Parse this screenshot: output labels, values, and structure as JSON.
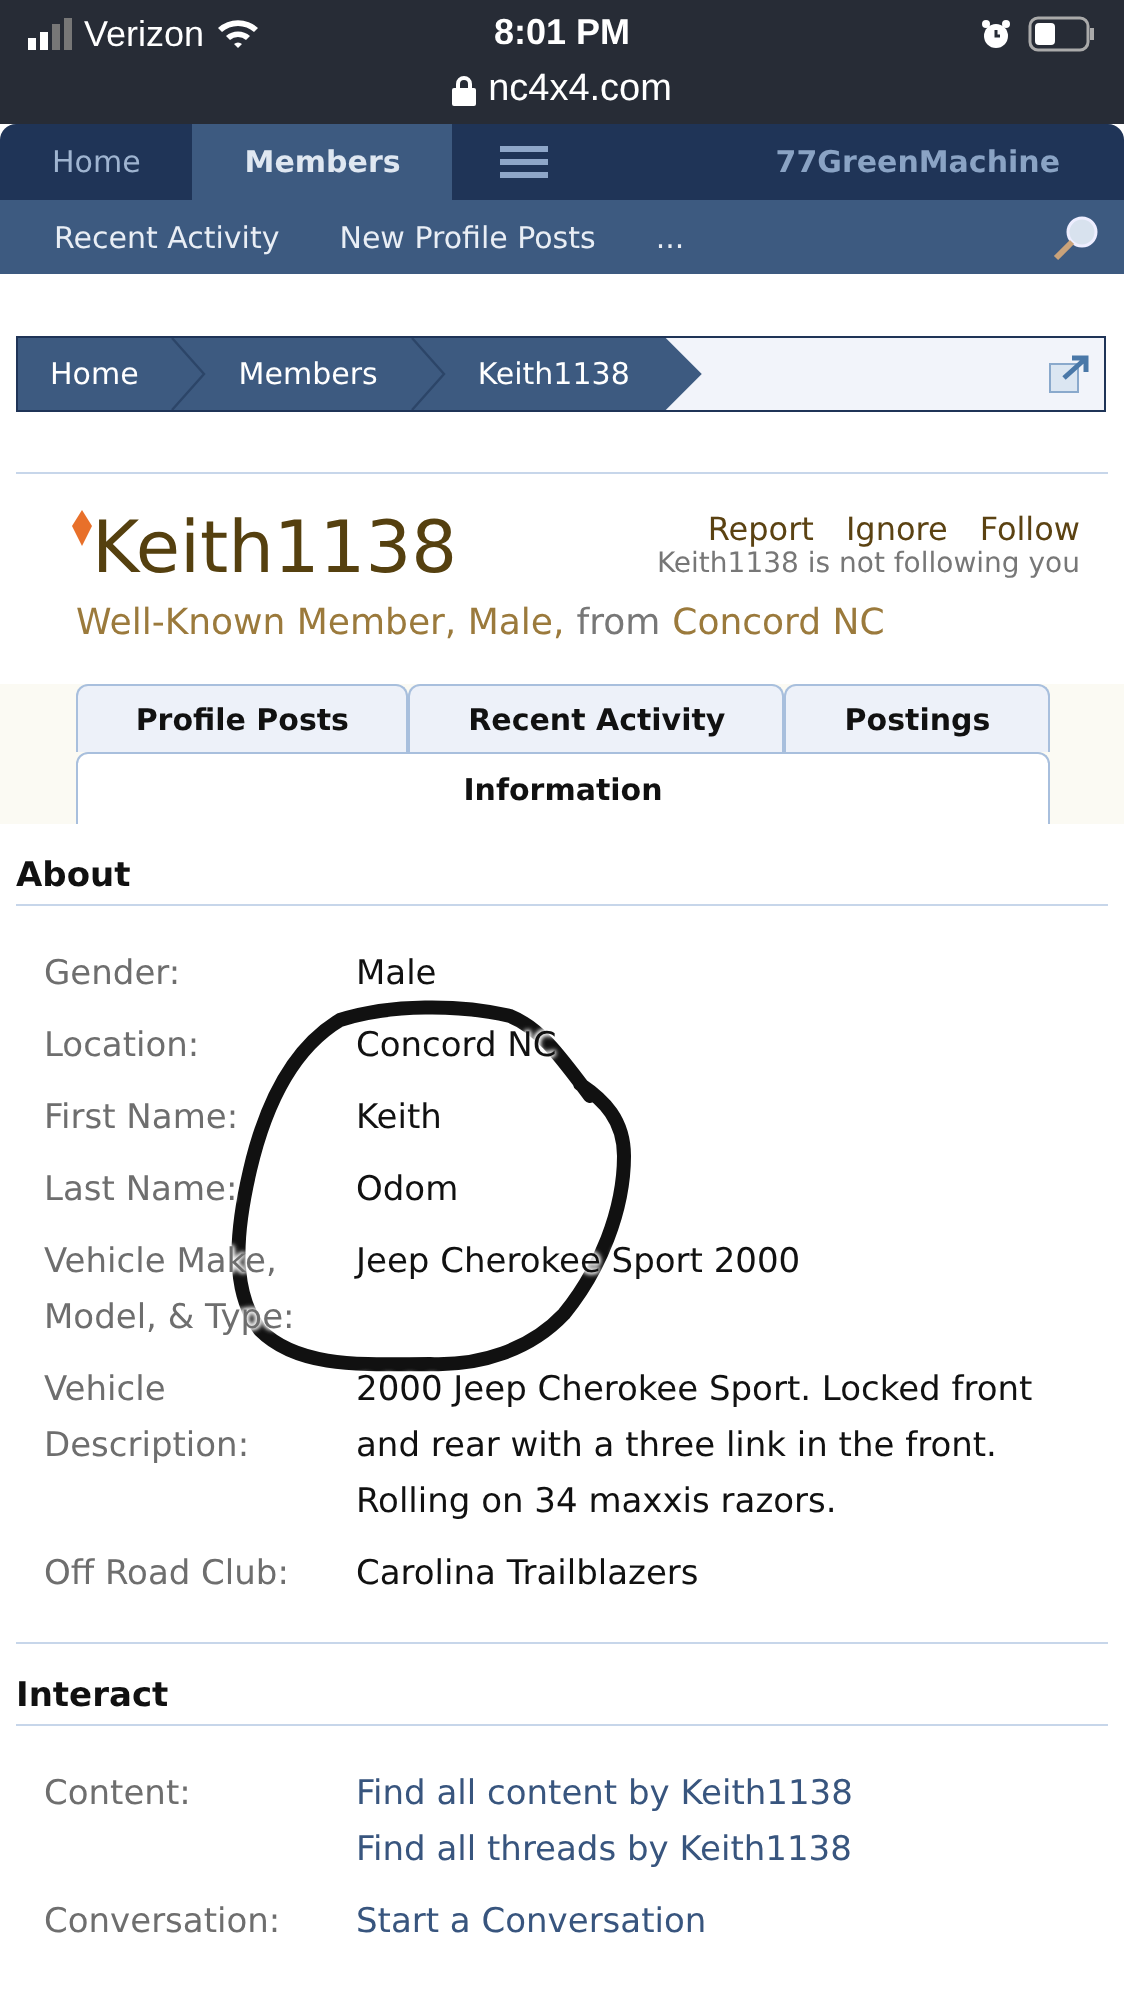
{
  "status_bar": {
    "carrier": "Verizon",
    "time": "8:01 PM",
    "url": "nc4x4.com"
  },
  "nav": {
    "tabs": [
      {
        "label": "Home",
        "selected": false
      },
      {
        "label": "Members",
        "selected": true
      }
    ],
    "user": "77GreenMachine"
  },
  "subnav": {
    "items": [
      "Recent Activity",
      "New Profile Posts",
      "..."
    ]
  },
  "breadcrumb": [
    "Home",
    "Members",
    "Keith1138"
  ],
  "profile": {
    "username": "Keith1138",
    "actions": [
      "Report",
      "Ignore",
      "Follow"
    ],
    "follow_status": "Keith1138 is not following you",
    "info_line": [
      {
        "text": "Well-Known Member, Male,",
        "kind": "link"
      },
      {
        "text": "from",
        "kind": "plain"
      },
      {
        "text": "Concord NC",
        "kind": "link"
      }
    ]
  },
  "tabs": [
    {
      "label": "Profile Posts",
      "selected": false
    },
    {
      "label": "Recent Activity",
      "selected": false
    },
    {
      "label": "Postings",
      "selected": false
    },
    {
      "label": "Information",
      "selected": true
    }
  ],
  "sections": [
    {
      "heading": "About",
      "rows": [
        {
          "label": "Gender:",
          "kind": "text",
          "values": [
            "Male"
          ]
        },
        {
          "label": "Location:",
          "kind": "text",
          "values": [
            "Concord NC"
          ]
        },
        {
          "label": "First Name:",
          "kind": "text",
          "values": [
            "Keith"
          ]
        },
        {
          "label": "Last Name:",
          "kind": "text",
          "values": [
            "Odom"
          ]
        },
        {
          "label": "Vehicle Make, Model, & Type:",
          "kind": "text",
          "values": [
            "Jeep Cherokee Sport 2000"
          ]
        },
        {
          "label": "Vehicle Description:",
          "kind": "text",
          "values": [
            "2000 Jeep Cherokee Sport. Locked front and rear with a three link in the front. Rolling on 34 maxxis razors."
          ]
        },
        {
          "label": "Off Road Club:",
          "kind": "text",
          "values": [
            "Carolina Trailblazers"
          ]
        }
      ]
    },
    {
      "heading": "Interact",
      "rows": [
        {
          "label": "Content:",
          "kind": "link",
          "values": [
            "Find all content by Keith1138",
            "Find all threads by Keith1138"
          ]
        },
        {
          "label": "Conversation:",
          "kind": "link",
          "values": [
            "Start a Conversation"
          ]
        }
      ]
    }
  ]
}
